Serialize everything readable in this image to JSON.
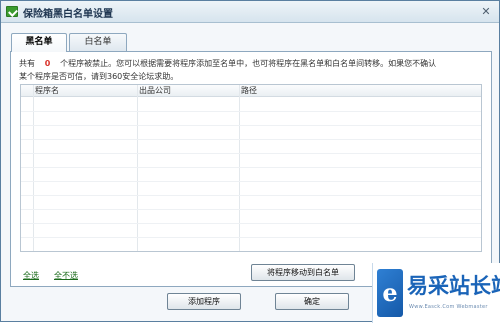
{
  "window": {
    "title": "保险箱黑白名单设置",
    "close_symbol": "✕"
  },
  "tabs": [
    {
      "label": "黑名单",
      "active": true
    },
    {
      "label": "白名单",
      "active": false
    }
  ],
  "description": {
    "prefix": "共有",
    "count": "0",
    "text1": "个程序被禁止。您可以根据需要将程序添加至名单中，也可将程序在黑名单和白名单间转移。如果您不确认",
    "text2": "某个程序是否可信，请到360安全论坛求助。"
  },
  "table": {
    "columns": [
      "程序名",
      "出品公司",
      "路径"
    ],
    "rows": []
  },
  "links": {
    "select_all": "全选",
    "select_none": "全不选"
  },
  "buttons": {
    "move_to_whitelist": "将程序移动到白名单",
    "add_program": "添加程序",
    "ok": "确定"
  },
  "watermark": {
    "mark": "e",
    "text": "易采站长站",
    "subtext": "Www.Easck.Com Webmaster"
  },
  "colors": {
    "accent": "#1a64b8",
    "count": "#d9322a",
    "link": "#1a6a1a"
  }
}
